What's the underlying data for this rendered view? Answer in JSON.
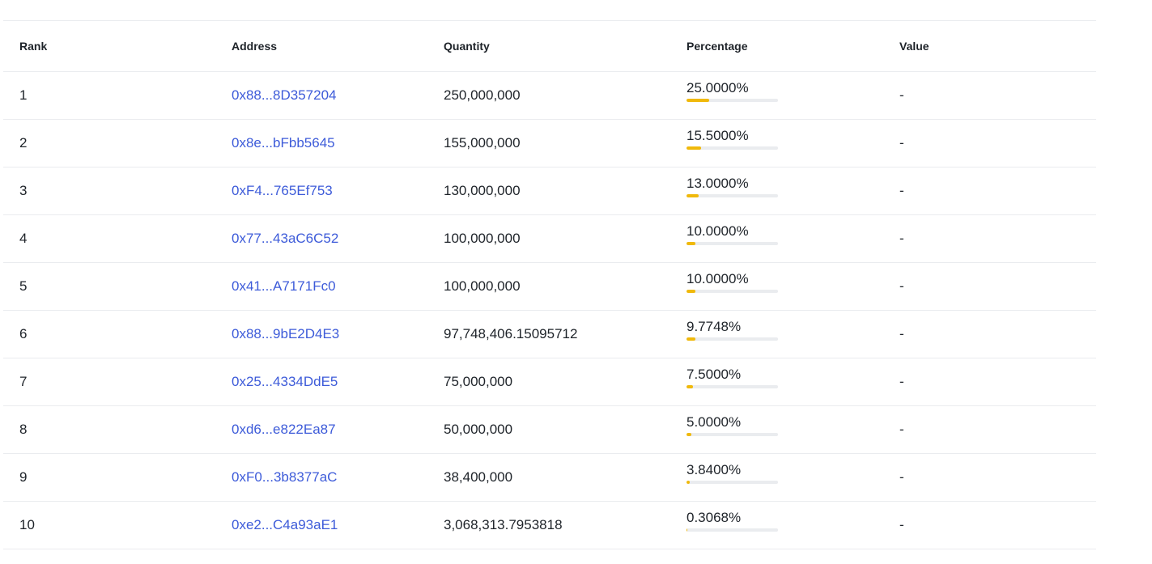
{
  "table": {
    "headers": {
      "rank": "Rank",
      "address": "Address",
      "quantity": "Quantity",
      "percentage": "Percentage",
      "value": "Value"
    },
    "rows": [
      {
        "rank": "1",
        "address": "0x88...8D357204",
        "quantity": "250,000,000",
        "percentage": "25.0000%",
        "pct_value": 25.0,
        "value": "-"
      },
      {
        "rank": "2",
        "address": "0x8e...bFbb5645",
        "quantity": "155,000,000",
        "percentage": "15.5000%",
        "pct_value": 15.5,
        "value": "-"
      },
      {
        "rank": "3",
        "address": "0xF4...765Ef753",
        "quantity": "130,000,000",
        "percentage": "13.0000%",
        "pct_value": 13.0,
        "value": "-"
      },
      {
        "rank": "4",
        "address": "0x77...43aC6C52",
        "quantity": "100,000,000",
        "percentage": "10.0000%",
        "pct_value": 10.0,
        "value": "-"
      },
      {
        "rank": "5",
        "address": "0x41...A7171Fc0",
        "quantity": "100,000,000",
        "percentage": "10.0000%",
        "pct_value": 10.0,
        "value": "-"
      },
      {
        "rank": "6",
        "address": "0x88...9bE2D4E3",
        "quantity": "97,748,406.15095712",
        "percentage": "9.7748%",
        "pct_value": 9.7748,
        "value": "-"
      },
      {
        "rank": "7",
        "address": "0x25...4334DdE5",
        "quantity": "75,000,000",
        "percentage": "7.5000%",
        "pct_value": 7.5,
        "value": "-"
      },
      {
        "rank": "8",
        "address": "0xd6...e822Ea87",
        "quantity": "50,000,000",
        "percentage": "5.0000%",
        "pct_value": 5.0,
        "value": "-"
      },
      {
        "rank": "9",
        "address": "0xF0...3b8377aC",
        "quantity": "38,400,000",
        "percentage": "3.8400%",
        "pct_value": 3.84,
        "value": "-"
      },
      {
        "rank": "10",
        "address": "0xe2...C4a93aE1",
        "quantity": "3,068,313.7953818",
        "percentage": "0.3068%",
        "pct_value": 0.3068,
        "value": "-"
      }
    ]
  },
  "colors": {
    "link": "#3d5bd9",
    "bar_fill": "#f0b90b",
    "bar_track": "#eaecef"
  }
}
